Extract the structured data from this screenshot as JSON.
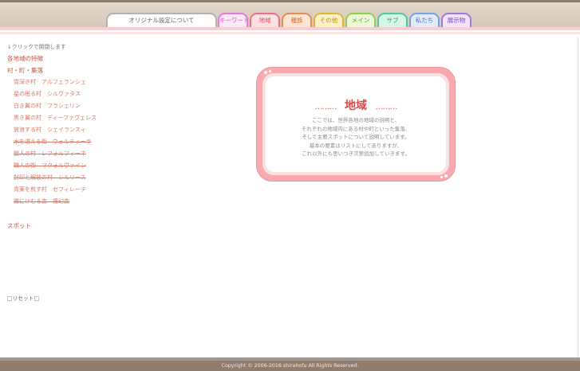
{
  "tabs": [
    {
      "label": "オリジナル設定について",
      "color": "#b8b0aa",
      "text": "#666666",
      "bg": "#ffffff",
      "active": true
    },
    {
      "label": "キーワード",
      "color": "#e87ad8",
      "text": "#d054c2",
      "bg": "#fde8fb"
    },
    {
      "label": "地域",
      "color": "#e8727f",
      "text": "#d8505e",
      "bg": "#fde1e4"
    },
    {
      "label": "種族",
      "color": "#e88a52",
      "text": "#d46a2c",
      "bg": "#fde6d6"
    },
    {
      "label": "その他",
      "color": "#e0b430",
      "text": "#c09012",
      "bg": "#fcf2c8"
    },
    {
      "label": "メイン",
      "color": "#8ed04a",
      "text": "#5ea524",
      "bg": "#ecf8d8"
    },
    {
      "label": "サブ",
      "color": "#4ec99a",
      "text": "#24a272",
      "bg": "#d8f5ea"
    },
    {
      "label": "私たち",
      "color": "#7aa0ec",
      "text": "#4c74d2",
      "bg": "#e2ebfc"
    },
    {
      "label": "展示物",
      "color": "#a07ad8",
      "text": "#7a4fc0",
      "bg": "#eee4fb"
    }
  ],
  "sidebar": {
    "hint": "↓クリックで開閉します",
    "cat_features": "各地域の特徴",
    "cat_villages": "村・町・集落",
    "items": [
      "雪深き村　アルフェランシェ",
      "星の眠る村　シルヴァタス",
      "白き翼の村　フラシェリン",
      "黒き翼の村　ディーファヴェレス",
      "放浪する村　シェイランスィ",
      "水を湛える街　ウォルティーラ",
      "獣人の村　レフォルフィーネ",
      "職人の街　マクォルヴァイン",
      "封印と解放の村　シルリース",
      "青薬を煎す村　セフィレーテ",
      "霧にけむる森　霧幻森"
    ],
    "cat_spots": "スポット",
    "reset": "□リセット□"
  },
  "card": {
    "dash_left": "………",
    "title": "地域",
    "dash_right": "………",
    "lines": [
      "ここでは、世界各地の地域の説明と、",
      "それぞれの地域内にある村や町といった集落、",
      "そして主要スポットについて説明しています。",
      "基本の要素はリストにしてありますが、",
      "これ以外にも思いつき次第追加していきます。"
    ]
  },
  "footer": {
    "copyright": "Copyright © 2006-2016 shirahofu All Rights Reserved."
  },
  "colors": {
    "accent": "#d84a4a",
    "frame_pink": "#f7aab0",
    "footer": "#8f7d70"
  }
}
